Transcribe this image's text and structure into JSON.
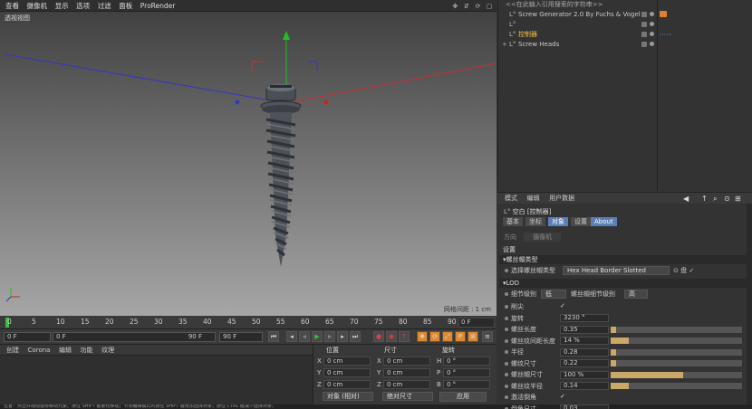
{
  "viewport": {
    "menu": [
      "查看",
      "摄像机",
      "显示",
      "选项",
      "过滤",
      "面板",
      "ProRender"
    ],
    "label": "透视视图",
    "grid_label": "网格间距 : 1 cm"
  },
  "timeline": {
    "ticks": [
      "0",
      "5",
      "10",
      "15",
      "20",
      "25",
      "30",
      "35",
      "40",
      "45",
      "50",
      "55",
      "60",
      "65",
      "70",
      "75",
      "80",
      "85",
      "90"
    ],
    "frame": "0 F"
  },
  "transport": {
    "current": "0 F",
    "min": "0 F",
    "max_range": "90 F",
    "end": "90 F"
  },
  "material_menu": [
    "创建",
    "Corona",
    "编辑",
    "功能",
    "纹理"
  ],
  "coordinates": {
    "headers": [
      "位置",
      "尺寸",
      "旋转"
    ],
    "rows": [
      {
        "axis": "X",
        "pos": "0 cm",
        "size_axis": "X",
        "size": "0 cm",
        "rot_axis": "H",
        "rot": "0 °"
      },
      {
        "axis": "Y",
        "pos": "0 cm",
        "size_axis": "Y",
        "size": "0 cm",
        "rot_axis": "P",
        "rot": "0 °"
      },
      {
        "axis": "Z",
        "pos": "0 cm",
        "size_axis": "Z",
        "size": "0 cm",
        "rot_axis": "B",
        "rot": "0 °"
      }
    ],
    "mode1": "对象 (相对)",
    "mode2": "绝对尺寸",
    "apply": "应用"
  },
  "status": "位置：点击并拖动鼠标移动元素。按住 SHIFT 键量化移动；节点编辑模式时按住 SHIFT 键增加选择对象；按住 CTRL 键减少选择对象。",
  "objects": {
    "items": [
      {
        "name": "<<在此输入引用搜索的字符串>>",
        "indent": 0
      },
      {
        "name": "Screw Generator 2.0 By Fuchs & Vogel",
        "indent": 1
      },
      {
        "name": "",
        "indent": 1
      },
      {
        "name": "控制器",
        "indent": 1,
        "highlight": true
      },
      {
        "name": "Screw Heads",
        "indent": 1
      }
    ]
  },
  "attributes": {
    "menu": [
      "模式",
      "编辑",
      "用户数据"
    ],
    "object_title": "空白 [控制器]",
    "tabs": [
      "基本",
      "坐标",
      "对象",
      "设置",
      "About"
    ],
    "active_tabs": [
      2,
      4
    ],
    "direction_label": "方向",
    "direction_value": "摄像机",
    "section_settings": "设置",
    "section_head": "▾螺丝帽类型",
    "head_type_label": "选择螺丝帽类型",
    "head_type_value": "Hex Head Border Slotted",
    "section_lod": "▾LOD",
    "detail_label": "细节级别",
    "detail_value": "低",
    "cap_detail_label": "螺丝帽细节级别",
    "cap_detail_value": "高",
    "params": [
      {
        "label": "削尖",
        "value": "✓",
        "bar": null
      },
      {
        "label": "旋转",
        "value": "3230 °",
        "bar": null
      },
      {
        "label": "螺丝长度",
        "value": "0.35",
        "bar": 0.04
      },
      {
        "label": "螺丝纹间距长度",
        "value": "14 %",
        "bar": 0.14
      },
      {
        "label": "半径",
        "value": "0.28",
        "bar": 0.04
      },
      {
        "label": "螺纹尺寸",
        "value": "0.22",
        "bar": 0.04
      },
      {
        "label": "螺丝帽尺寸",
        "value": "100 %",
        "bar": 0.55
      },
      {
        "label": "螺丝纹半径",
        "value": "0.14",
        "bar": 0.14
      },
      {
        "label": "激活倒角",
        "value": "✓",
        "bar": null
      },
      {
        "label": "倒角尺寸",
        "value": "0.03",
        "bar": null
      }
    ]
  },
  "colors": {
    "accent": "#5a7fb5",
    "highlight_text": "#f0c040",
    "axis_x": "#d02020",
    "axis_y": "#20c020",
    "axis_z": "#3030d0"
  }
}
